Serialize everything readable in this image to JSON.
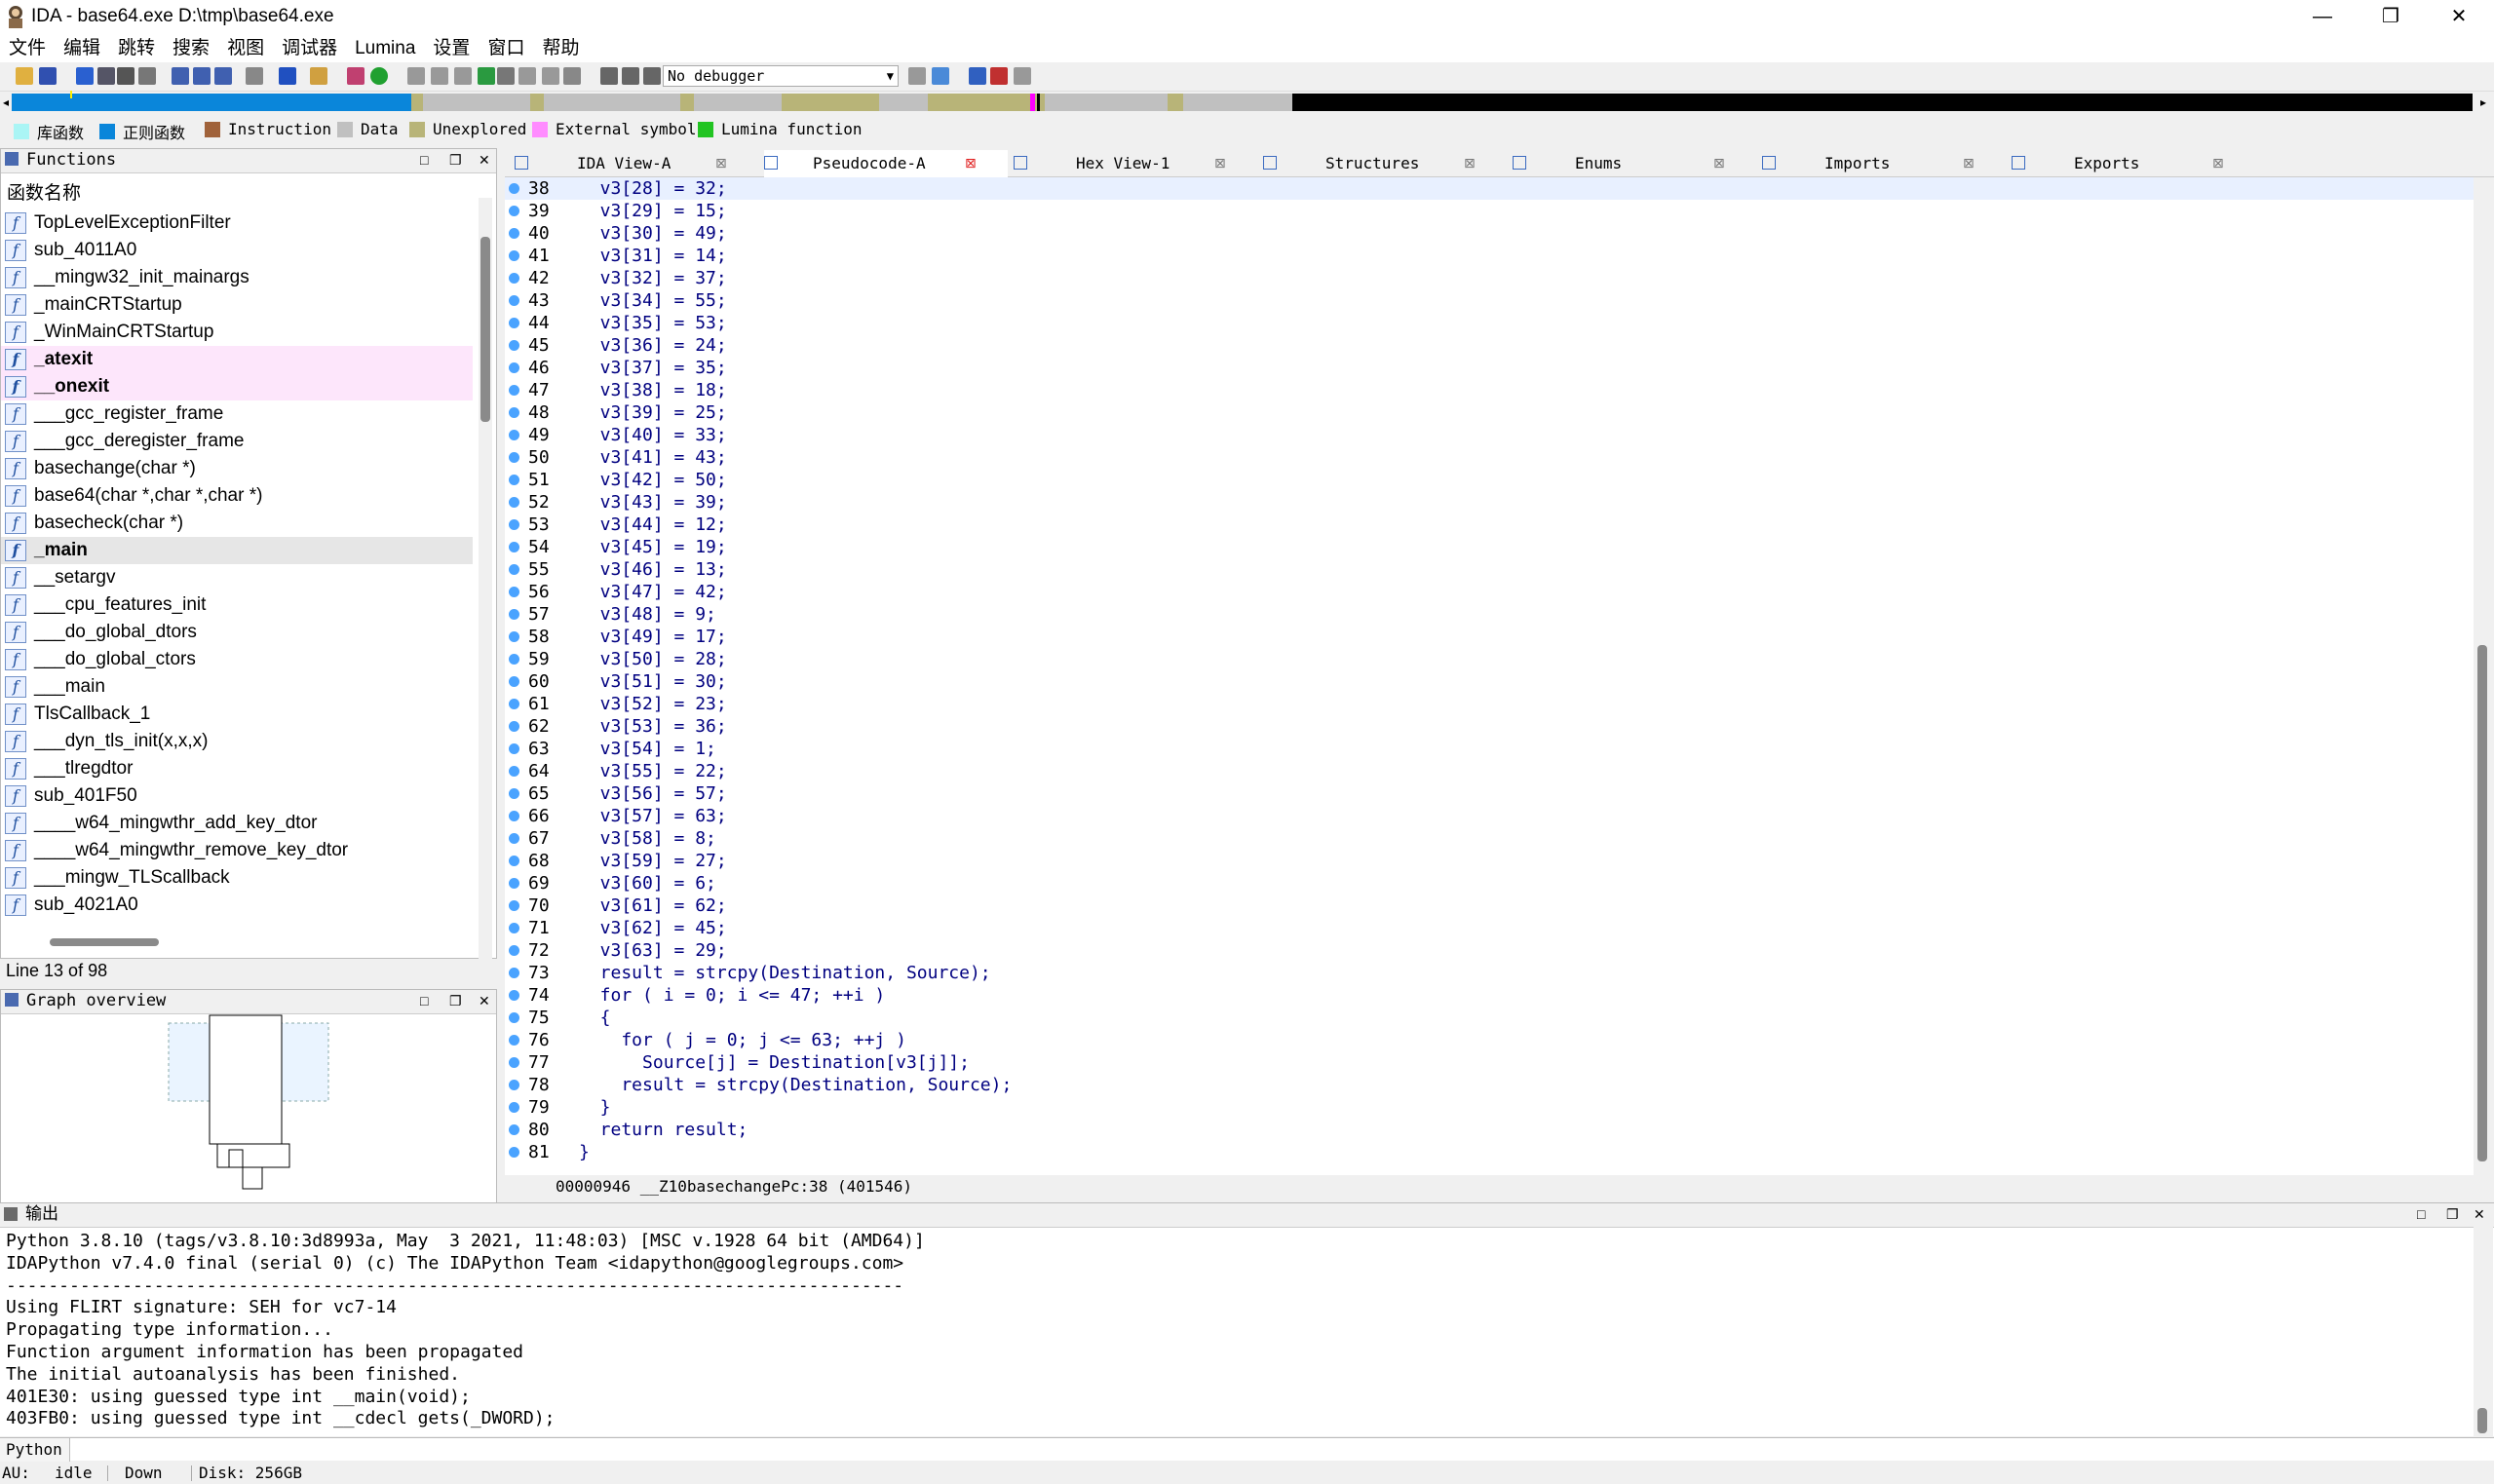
{
  "window": {
    "title": "IDA - base64.exe D:\\tmp\\base64.exe",
    "controls": [
      "—",
      "❐",
      "✕"
    ]
  },
  "menu": [
    "文件",
    "编辑",
    "跳转",
    "搜索",
    "视图",
    "调试器",
    "Lumina",
    "设置",
    "窗口",
    "帮助"
  ],
  "toolbar": {
    "debugger": "No debugger"
  },
  "legend": [
    {
      "label": "库函数",
      "color": "#aaf5f5"
    },
    {
      "label": "正则函数",
      "color": "#0a86da"
    },
    {
      "label": "Instruction",
      "color": "#a0623a"
    },
    {
      "label": "Data",
      "color": "#c0c0c0"
    },
    {
      "label": "Unexplored",
      "color": "#b8b478"
    },
    {
      "label": "External symbol",
      "color": "#ff8cff"
    },
    {
      "label": "Lumina function",
      "color": "#22c422"
    }
  ],
  "functions_panel": {
    "title": "Functions",
    "column": "函数名称",
    "status": "Line 13 of 98",
    "items": [
      {
        "name": "TopLevelExceptionFilter",
        "style": ""
      },
      {
        "name": "sub_4011A0",
        "style": ""
      },
      {
        "name": "__mingw32_init_mainargs",
        "style": ""
      },
      {
        "name": "_mainCRTStartup",
        "style": ""
      },
      {
        "name": "_WinMainCRTStartup",
        "style": ""
      },
      {
        "name": "_atexit",
        "style": "lib"
      },
      {
        "name": "__onexit",
        "style": "lib"
      },
      {
        "name": "___gcc_register_frame",
        "style": ""
      },
      {
        "name": "___gcc_deregister_frame",
        "style": ""
      },
      {
        "name": "basechange(char *)",
        "style": ""
      },
      {
        "name": "base64(char *,char *,char *)",
        "style": ""
      },
      {
        "name": "basecheck(char *)",
        "style": ""
      },
      {
        "name": "_main",
        "style": "sel"
      },
      {
        "name": "__setargv",
        "style": ""
      },
      {
        "name": "___cpu_features_init",
        "style": ""
      },
      {
        "name": "___do_global_dtors",
        "style": ""
      },
      {
        "name": "___do_global_ctors",
        "style": ""
      },
      {
        "name": "___main",
        "style": ""
      },
      {
        "name": "TlsCallback_1",
        "style": ""
      },
      {
        "name": "___dyn_tls_init(x,x,x)",
        "style": ""
      },
      {
        "name": "___tlregdtor",
        "style": ""
      },
      {
        "name": "sub_401F50",
        "style": ""
      },
      {
        "name": "____w64_mingwthr_add_key_dtor",
        "style": ""
      },
      {
        "name": "____w64_mingwthr_remove_key_dtor",
        "style": ""
      },
      {
        "name": "___mingw_TLScallback",
        "style": ""
      },
      {
        "name": "sub_4021A0",
        "style": ""
      }
    ]
  },
  "graph_panel": {
    "title": "Graph overview"
  },
  "tabs": [
    {
      "label": "IDA View-A",
      "active": false
    },
    {
      "label": "Pseudocode-A",
      "active": true
    },
    {
      "label": "Hex View-1",
      "active": false
    },
    {
      "label": "Structures",
      "active": false
    },
    {
      "label": "Enums",
      "active": false
    },
    {
      "label": "Imports",
      "active": false
    },
    {
      "label": "Exports",
      "active": false
    }
  ],
  "code": {
    "lines": [
      {
        "n": "38",
        "t": "  v3[28] = 32;"
      },
      {
        "n": "39",
        "t": "  v3[29] = 15;"
      },
      {
        "n": "40",
        "t": "  v3[30] = 49;"
      },
      {
        "n": "41",
        "t": "  v3[31] = 14;"
      },
      {
        "n": "42",
        "t": "  v3[32] = 37;"
      },
      {
        "n": "43",
        "t": "  v3[34] = 55;"
      },
      {
        "n": "44",
        "t": "  v3[35] = 53;"
      },
      {
        "n": "45",
        "t": "  v3[36] = 24;"
      },
      {
        "n": "46",
        "t": "  v3[37] = 35;"
      },
      {
        "n": "47",
        "t": "  v3[38] = 18;"
      },
      {
        "n": "48",
        "t": "  v3[39] = 25;"
      },
      {
        "n": "49",
        "t": "  v3[40] = 33;"
      },
      {
        "n": "50",
        "t": "  v3[41] = 43;"
      },
      {
        "n": "51",
        "t": "  v3[42] = 50;"
      },
      {
        "n": "52",
        "t": "  v3[43] = 39;"
      },
      {
        "n": "53",
        "t": "  v3[44] = 12;"
      },
      {
        "n": "54",
        "t": "  v3[45] = 19;"
      },
      {
        "n": "55",
        "t": "  v3[46] = 13;"
      },
      {
        "n": "56",
        "t": "  v3[47] = 42;"
      },
      {
        "n": "57",
        "t": "  v3[48] = 9;"
      },
      {
        "n": "58",
        "t": "  v3[49] = 17;"
      },
      {
        "n": "59",
        "t": "  v3[50] = 28;"
      },
      {
        "n": "60",
        "t": "  v3[51] = 30;"
      },
      {
        "n": "61",
        "t": "  v3[52] = 23;"
      },
      {
        "n": "62",
        "t": "  v3[53] = 36;"
      },
      {
        "n": "63",
        "t": "  v3[54] = 1;"
      },
      {
        "n": "64",
        "t": "  v3[55] = 22;"
      },
      {
        "n": "65",
        "t": "  v3[56] = 57;"
      },
      {
        "n": "66",
        "t": "  v3[57] = 63;"
      },
      {
        "n": "67",
        "t": "  v3[58] = 8;"
      },
      {
        "n": "68",
        "t": "  v3[59] = 27;"
      },
      {
        "n": "69",
        "t": "  v3[60] = 6;"
      },
      {
        "n": "70",
        "t": "  v3[61] = 62;"
      },
      {
        "n": "71",
        "t": "  v3[62] = 45;"
      },
      {
        "n": "72",
        "t": "  v3[63] = 29;"
      },
      {
        "n": "73",
        "t": "  result = strcpy(Destination, Source);"
      },
      {
        "n": "74",
        "t": "  for ( i = 0; i <= 47; ++i )"
      },
      {
        "n": "75",
        "t": "  {"
      },
      {
        "n": "76",
        "t": "    for ( j = 0; j <= 63; ++j )"
      },
      {
        "n": "77",
        "t": "      Source[j] = Destination[v3[j]];"
      },
      {
        "n": "78",
        "t": "    result = strcpy(Destination, Source);"
      },
      {
        "n": "79",
        "t": "  }"
      },
      {
        "n": "80",
        "t": "  return result;"
      },
      {
        "n": "81",
        "t": "}"
      }
    ],
    "status": "00000946 __Z10basechangePc:38 (401546)"
  },
  "output_panel": {
    "title": "输出",
    "lines": [
      "Python 3.8.10 (tags/v3.8.10:3d8993a, May  3 2021, 11:48:03) [MSC v.1928 64 bit (AMD64)]",
      "IDAPython v7.4.0 final (serial 0) (c) The IDAPython Team <idapython@googlegroups.com>",
      "-------------------------------------------------------------------------------------",
      "Using FLIRT signature: SEH for vc7-14",
      "Propagating type information...",
      "Function argument information has been propagated",
      "The initial autoanalysis has been finished.",
      "401E30: using guessed type int __main(void);",
      "403FB0: using guessed type int __cdecl gets(_DWORD);"
    ]
  },
  "python_input": {
    "label": "Python"
  },
  "statusbar": {
    "au": "AU:",
    "state": "idle",
    "dir": "Down",
    "disk": "Disk: 256GB"
  }
}
